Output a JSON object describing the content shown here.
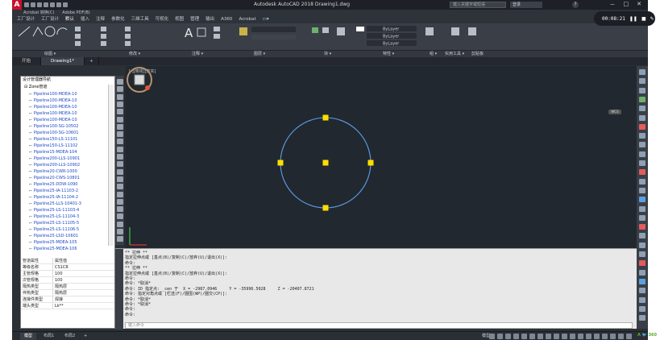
{
  "titlebar": {
    "title": "Autodesk AutoCAD 2018   Drawing1.dwg",
    "search_placeholder": "键入关键字或短语",
    "user": "登录",
    "help": "?",
    "min": "－",
    "max": "□",
    "close": "✕"
  },
  "addins": [
    "Acrobat 转换(C)",
    "Adobe PDF(B)"
  ],
  "ribbon_tabs": [
    "工厂设计",
    "工厂设计",
    "默认",
    "插入",
    "注释",
    "参数化",
    "三维工具",
    "可视化",
    "视图",
    "管理",
    "输出",
    "A360",
    "Acrobat",
    "▭▾"
  ],
  "ribbon_panels": [
    "绘图 ▾",
    "修改 ▾",
    "注释 ▾",
    "图层 ▾",
    "块 ▾",
    "特性 ▾",
    "组 ▾",
    "实用工具 ▾",
    "剪贴板"
  ],
  "layer_props": {
    "color": "ByLayer",
    "linetype": "ByLayer",
    "lineweight": "ByLayer"
  },
  "doc_tabs": [
    "开始",
    "Drawing1*",
    "+"
  ],
  "viewport_label": "[-][俯视][真实]",
  "wcs": "WCS",
  "recorder": {
    "time": "00:08:21"
  },
  "tree": {
    "title": "设计管理器导航",
    "root": "Zone管道",
    "items": [
      "Pipeline100-MDEA-10",
      "Pipeline100-MDEA-10",
      "Pipeline100-MDEA-10",
      "Pipeline100-MDEA-10",
      "Pipeline100-MDEA-10",
      "Pipeline100-SG-10502",
      "Pipeline100-SG-10601",
      "Pipeline150-LS-11101",
      "Pipeline150-LS-11102",
      "Pipeline15-MDEA-104",
      "Pipeline200-LLS-10901",
      "Pipeline200-LLS-10902",
      "Pipeline20-CWR-1000",
      "Pipeline20-CWS-10801",
      "Pipeline25-DDW-1090",
      "Pipeline25-IA-11103-2",
      "Pipeline25-IA-11104-2",
      "Pipeline25-LLS-10401-3",
      "Pipeline25-LS-11103-4",
      "Pipeline25-LS-11104-3",
      "Pipeline25-LS-11105-5",
      "Pipeline25-LS-11106-5",
      "Pipeline25-LSD-10601",
      "Pipeline25-MDEA-105",
      "Pipeline25-MDEA-106"
    ]
  },
  "properties": [
    {
      "k": "管道属性",
      "v": "属性值"
    },
    {
      "k": "等级名称",
      "v": "CS1CR"
    },
    {
      "k": "主管规格",
      "v": "100"
    },
    {
      "k": "次管规格",
      "v": "100"
    },
    {
      "k": "隔热类型",
      "v": "隔热层"
    },
    {
      "k": "伴热类型",
      "v": "隔热层"
    },
    {
      "k": "连接件类型",
      "v": "焊接"
    },
    {
      "k": "端头类型",
      "v": "Lk**"
    }
  ],
  "command_lines": [
    "** 拉伸 **",
    "指定拉伸点或 [基点(B)/复制(C)/放弃(U)/退出(X)]:",
    "命令:",
    "** 拉伸 **",
    "指定拉伸点或 [基点(B)/复制(C)/放弃(U)/退出(X)]:",
    "命令:",
    "命令: *取消*",
    "命令: ID 指定点: _cen 于  X = -2987.0946     Y = -35996.5028     Z = -20407.8721",
    "命令: 指定对角点或 [栏选(F)/圈围(WP)/圈交(CP)]:",
    "命令: *取消*",
    "命令: *取消*",
    "命令:",
    "命令:"
  ],
  "command_placeholder": "键入命令",
  "layout_tabs": [
    "模型",
    "布局1",
    "布局2",
    "+"
  ],
  "status": {
    "model": "模型",
    "brand": "A 🐦 360"
  }
}
